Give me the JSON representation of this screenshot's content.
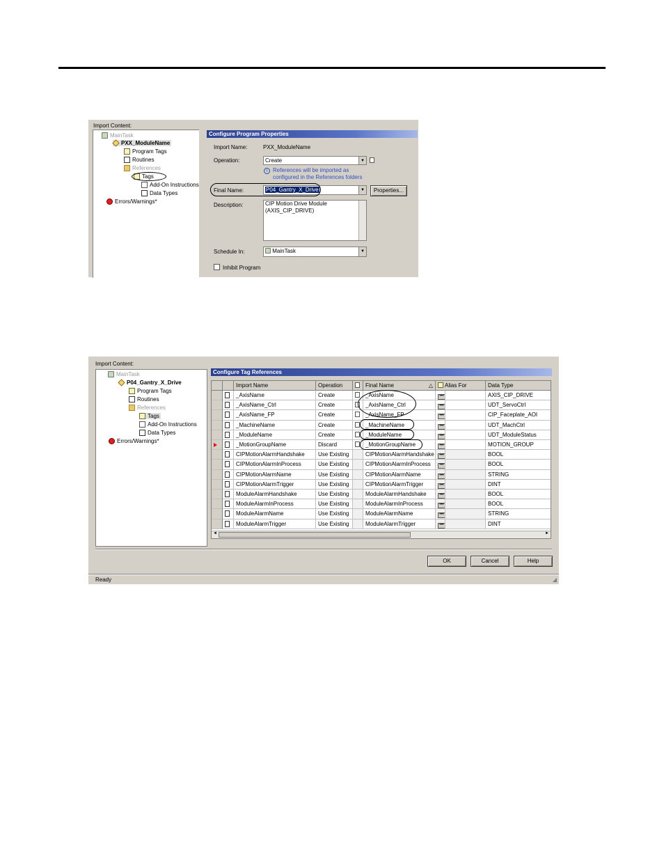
{
  "shot1": {
    "import_content_label": "Import Content:",
    "tree": {
      "main_task": "MainTask",
      "program": "PXX_ModuleName",
      "program_tags": "Program Tags",
      "routines": "Routines",
      "references": "References",
      "tags": "Tags",
      "aoi": "Add-On Instructions",
      "data_types": "Data Types",
      "errors": "Errors/Warnings*"
    },
    "panel_title": "Configure Program Properties",
    "import_name_label": "Import Name:",
    "import_name_value": "PXX_ModuleName",
    "operation_label": "Operation:",
    "operation_value": "Create",
    "info_line1": "References will be imported as",
    "info_line2": "configured in the References folders",
    "final_name_label": "Final Name:",
    "final_name_value": "P04_Gantry_X_Drive",
    "properties_button": "Properties...",
    "description_label": "Description:",
    "description_line1": "CIP Motion Drive Module",
    "description_line2": "(AXIS_CIP_DRIVE)",
    "schedule_in_label": "Schedule In:",
    "schedule_in_value": "MainTask",
    "inhibit_label": "Inhibit Program"
  },
  "shot2": {
    "import_content_label": "Import Content:",
    "tree": {
      "main_task": "MainTask",
      "program": "P04_Gantry_X_Drive",
      "program_tags": "Program Tags",
      "routines": "Routines",
      "references": "References",
      "tags": "Tags",
      "aoi": "Add-On Instructions",
      "data_types": "Data Types",
      "errors": "Errors/Warnings*"
    },
    "panel_title": "Configure Tag References",
    "columns": [
      "Import Name",
      "Operation",
      "Final Name",
      "Alias For",
      "Data Type"
    ],
    "rows": [
      {
        "import": "_AxisName",
        "op": "Create",
        "final": "_AxisName",
        "alias": "",
        "type": "AXIS_CIP_DRIVE"
      },
      {
        "import": "_AxisName_Ctrl",
        "op": "Create",
        "final": "_AxisName_Ctrl",
        "alias": "",
        "type": "UDT_ServoCtrl"
      },
      {
        "import": "_AxisName_FP",
        "op": "Create",
        "final": "_AxisName_FP",
        "alias": "",
        "type": "CIP_Faceplate_AOI"
      },
      {
        "import": "_MachineName",
        "op": "Create",
        "final": "_MachineName",
        "alias": "",
        "type": "UDT_MachCtrl"
      },
      {
        "import": "_ModuleName",
        "op": "Create",
        "final": "_ModuleName",
        "alias": "",
        "type": "UDT_ModuleStatus"
      },
      {
        "import": "_MotionGroupName",
        "op": "Discard",
        "final": "_MotionGroupName",
        "alias": "",
        "type": "MOTION_GROUP"
      },
      {
        "import": "CIPMotionAlarmHandshake",
        "op": "Use Existing",
        "final": "CIPMotionAlarmHandshake",
        "alias": "",
        "type": "BOOL"
      },
      {
        "import": "CIPMotionAlarmInProcess",
        "op": "Use Existing",
        "final": "CIPMotionAlarmInProcess",
        "alias": "",
        "type": "BOOL"
      },
      {
        "import": "CIPMotionAlarmName",
        "op": "Use Existing",
        "final": "CIPMotionAlarmName",
        "alias": "",
        "type": "STRING"
      },
      {
        "import": "CIPMotionAlarmTrigger",
        "op": "Use Existing",
        "final": "CIPMotionAlarmTrigger",
        "alias": "",
        "type": "DINT"
      },
      {
        "import": "ModuleAlarmHandshake",
        "op": "Use Existing",
        "final": "ModuleAlarmHandshake",
        "alias": "",
        "type": "BOOL"
      },
      {
        "import": "ModuleAlarmInProcess",
        "op": "Use Existing",
        "final": "ModuleAlarmInProcess",
        "alias": "",
        "type": "BOOL"
      },
      {
        "import": "ModuleAlarmName",
        "op": "Use Existing",
        "final": "ModuleAlarmName",
        "alias": "",
        "type": "STRING"
      },
      {
        "import": "ModuleAlarmTrigger",
        "op": "Use Existing",
        "final": "ModuleAlarmTrigger",
        "alias": "",
        "type": "DINT"
      }
    ],
    "ok_button": "OK",
    "cancel_button": "Cancel",
    "help_button": "Help",
    "status": "Ready"
  }
}
